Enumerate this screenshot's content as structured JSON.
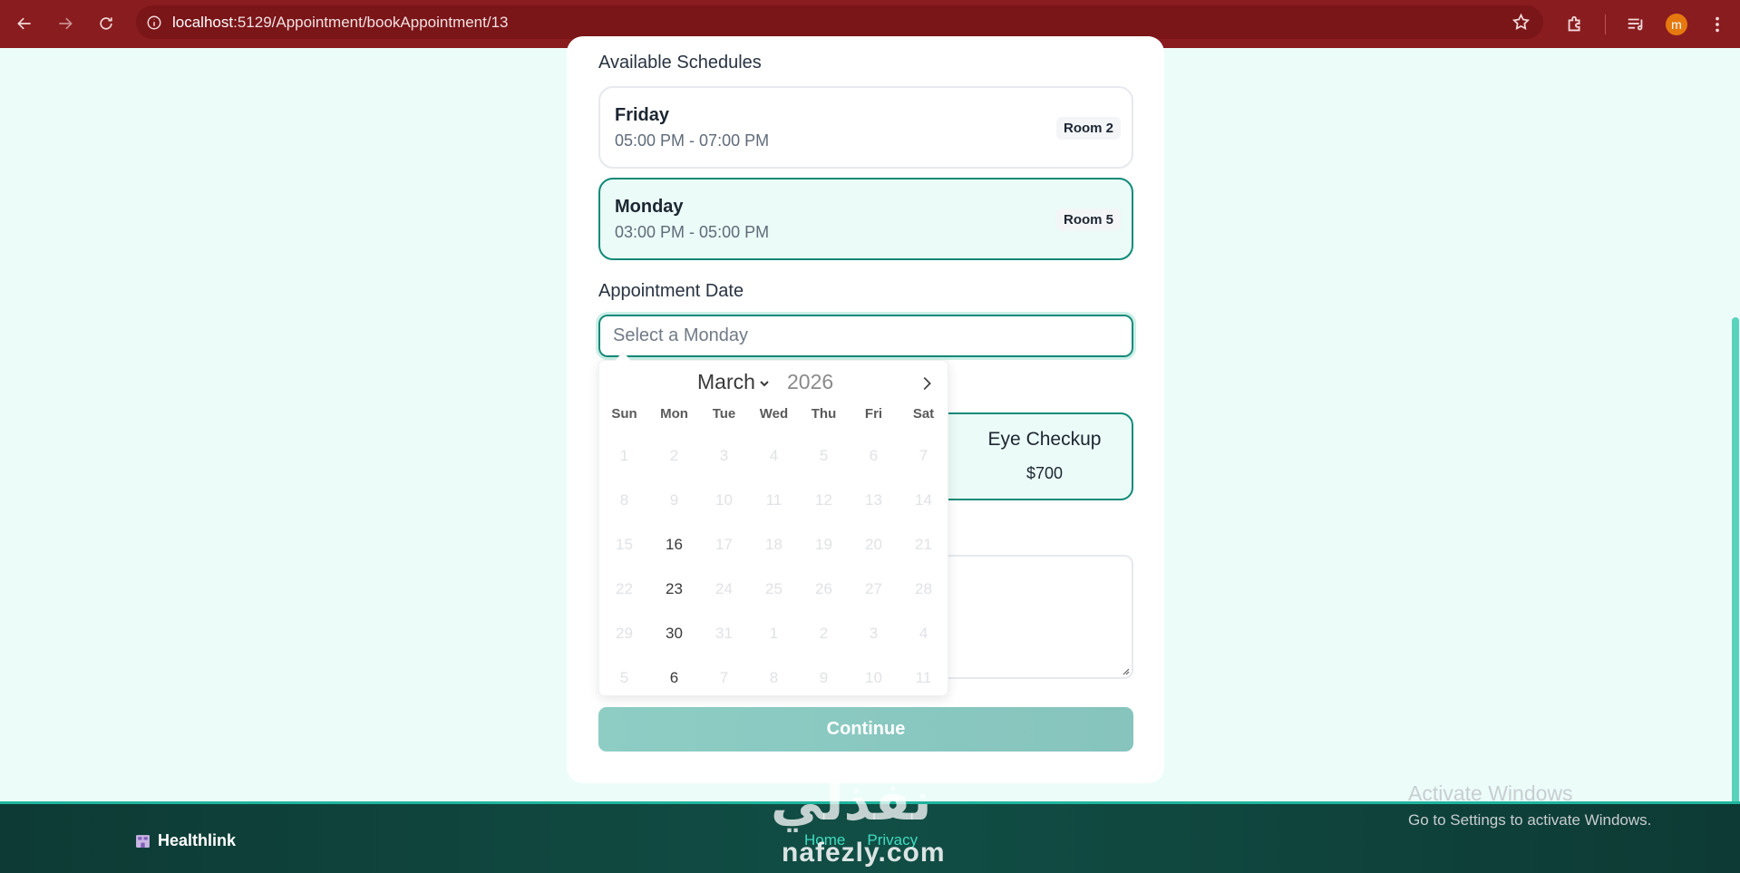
{
  "browser": {
    "url_host": "localhost",
    "url_path": ":5129/Appointment/bookAppointment/13",
    "avatar_letter": "m"
  },
  "schedules": {
    "label": "Available Schedules",
    "items": [
      {
        "day": "Friday",
        "time": "05:00 PM - 07:00 PM",
        "room": "Room 2",
        "selected": false
      },
      {
        "day": "Monday",
        "time": "03:00 PM - 05:00 PM",
        "room": "Room 5",
        "selected": true
      }
    ]
  },
  "appointment_date": {
    "label": "Appointment Date",
    "placeholder": "Select a Monday"
  },
  "calendar": {
    "month": "March",
    "year": "2026",
    "weekdays": [
      "Sun",
      "Mon",
      "Tue",
      "Wed",
      "Thu",
      "Fri",
      "Sat"
    ],
    "days": [
      "1",
      "2",
      "3",
      "4",
      "5",
      "6",
      "7",
      "8",
      "9",
      "10",
      "11",
      "12",
      "13",
      "14",
      "15",
      "16",
      "17",
      "18",
      "19",
      "20",
      "21",
      "22",
      "23",
      "24",
      "25",
      "26",
      "27",
      "28",
      "29",
      "30",
      "31",
      "1",
      "2",
      "3",
      "4",
      "5",
      "6",
      "7",
      "8",
      "9",
      "10",
      "11"
    ],
    "enabled_indices": [
      15,
      22,
      29,
      36
    ]
  },
  "service": {
    "name": "Eye Checkup",
    "price": "$700"
  },
  "continue_label": "Continue",
  "footer": {
    "brand": "Healthlink",
    "links": [
      "Home",
      "Privacy"
    ]
  },
  "watermark": {
    "latin": "nafezly.com",
    "arabic": "نفذلي"
  },
  "activate_windows": {
    "title": "Activate Windows",
    "subtitle": "Go to Settings to activate Windows."
  },
  "colors": {
    "accent": "#0f8a78",
    "chrome": "#891c1f",
    "footer": "#114e45"
  }
}
